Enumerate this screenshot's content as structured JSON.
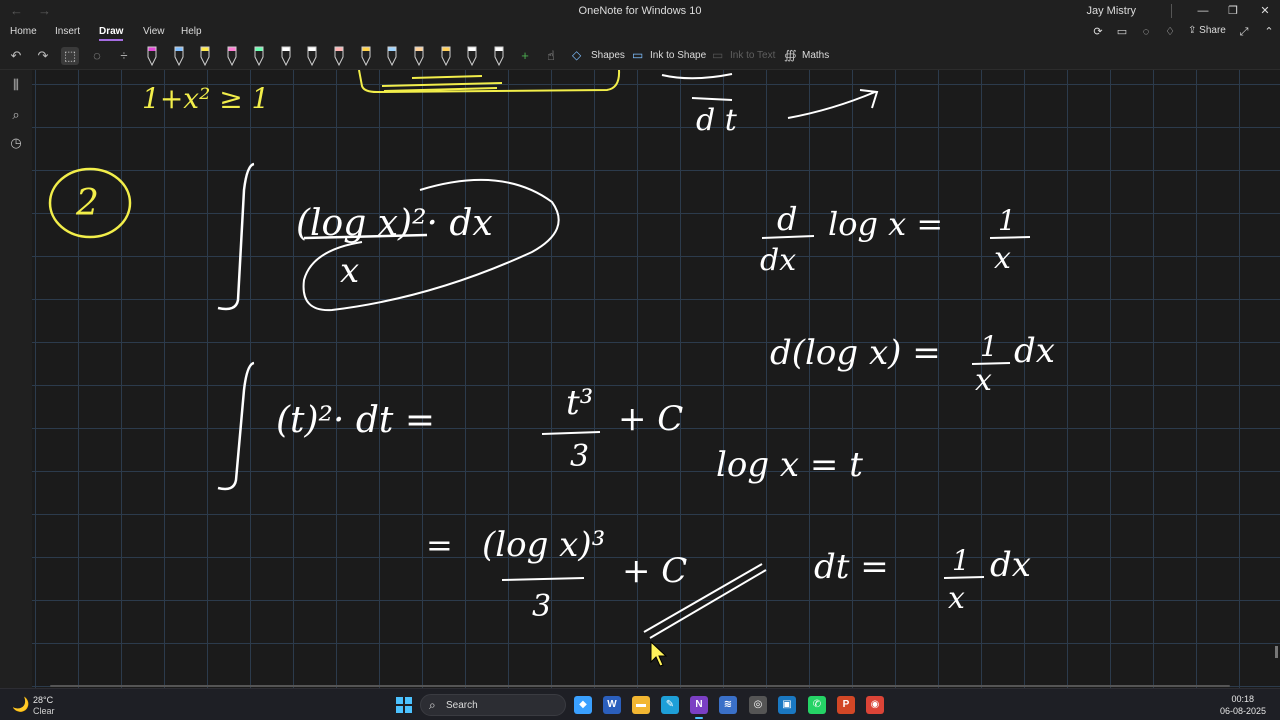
{
  "window": {
    "title": "OneNote for Windows 10",
    "user": "Jay Mistry",
    "minimize_glyph": "—",
    "maximize_glyph": "❐",
    "close_glyph": "✕"
  },
  "menu": {
    "tabs": [
      {
        "label": "Home"
      },
      {
        "label": "Insert"
      },
      {
        "label": "Draw",
        "active": true
      },
      {
        "label": "View"
      },
      {
        "label": "Help"
      }
    ],
    "share_label": "Share"
  },
  "toolbar": {
    "shapes_label": "Shapes",
    "ink_to_shape_label": "Ink to Shape",
    "ink_to_text_label": "Ink to Text",
    "maths_label": "Maths",
    "pens": [
      {
        "color": "#e04ad6"
      },
      {
        "color": "#7fbfff"
      },
      {
        "color": "#ffe94a"
      },
      {
        "color": "#ff7fd4"
      },
      {
        "color": "#69ffb0"
      },
      {
        "color": "#ffffff"
      },
      {
        "color": "#ffffff"
      },
      {
        "color": "#ffb3b3"
      },
      {
        "color": "#ffd24a"
      },
      {
        "color": "#9fd4ff"
      },
      {
        "color": "#ffd29a"
      },
      {
        "color": "#ffcf5a"
      },
      {
        "color": "#ffffff"
      },
      {
        "color": "#ffffff"
      }
    ]
  },
  "notes": {
    "ink_yellow": "#f2ee4a",
    "ink_white": "#ffffff",
    "yellow_fragment": "1+x² ≥ 1",
    "circled_number": "2",
    "deriv_fragment": "d t",
    "problem_numerator": "(log x)²· dx",
    "problem_denominator": "x",
    "rule_1_lhs": "d",
    "rule_1_lhs_den": "dx",
    "rule_1_mid": "log x =",
    "rule_1_rhs_num": "1",
    "rule_1_rhs_den": "x",
    "rule_2": "d(log x) =",
    "rule_2_num": "1",
    "rule_2_den": "x",
    "rule_2_tail": "dx",
    "step_1": "(t)²· dt  =",
    "step_1_num": "t³",
    "step_1_den": "3",
    "step_1_tail": "+ C",
    "subst": "log x = t",
    "step_2_eq": "=",
    "step_2_num": "(log x)³",
    "step_2_den": "3",
    "step_2_tail": "+ C",
    "dt_lhs": "dt  =",
    "dt_num": "1",
    "dt_den": "x",
    "dt_tail": "dx"
  },
  "taskbar": {
    "weather_temp": "28°C",
    "weather_desc": "Clear",
    "search_label": "Search",
    "time": "00:18",
    "date": "06-08-2025",
    "apps": [
      {
        "glyph": "◆",
        "color": "#3aa0ff"
      },
      {
        "glyph": "W",
        "color": "#2b5fbd"
      },
      {
        "glyph": "▬",
        "color": "#f2b632"
      },
      {
        "glyph": "✎",
        "color": "#1e9fd8"
      },
      {
        "glyph": "N",
        "color": "#7b3fc4",
        "active": true
      },
      {
        "glyph": "≋",
        "color": "#3a70c8"
      },
      {
        "glyph": "◎",
        "color": "#555555"
      },
      {
        "glyph": "▣",
        "color": "#1a78c2"
      },
      {
        "glyph": "✆",
        "color": "#25d366"
      },
      {
        "glyph": "P",
        "color": "#d24726"
      },
      {
        "glyph": "◉",
        "color": "#db4437"
      }
    ]
  }
}
